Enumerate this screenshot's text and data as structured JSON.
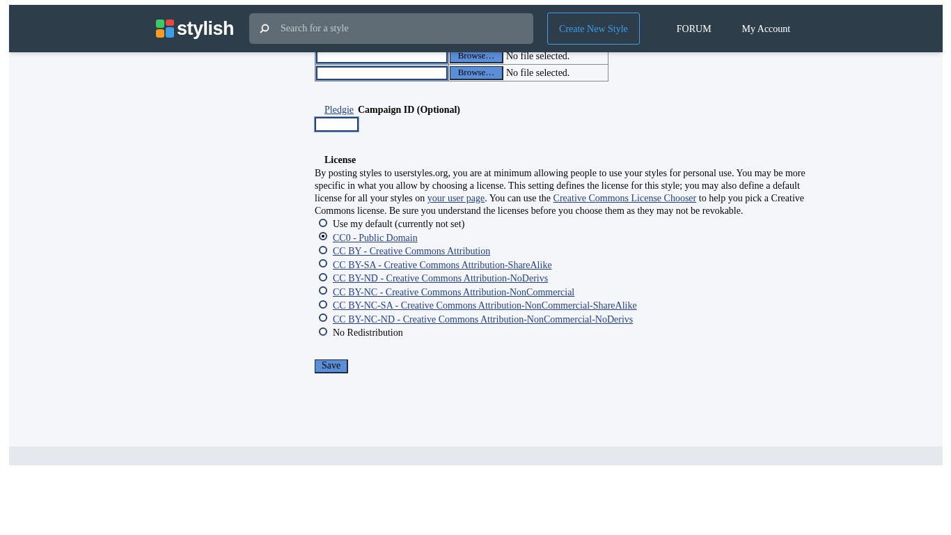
{
  "header": {
    "logo_text": "stylish",
    "search": {
      "placeholder": "Search for a style"
    },
    "create_button": "Create New Style",
    "nav": [
      "FORUM",
      "My Account"
    ]
  },
  "upload_rows": [
    {
      "button": "Browse…",
      "status": "No file selected."
    },
    {
      "button": "Browse…",
      "status": "No file selected."
    }
  ],
  "pledgie": {
    "link": "Pledgie",
    "label": "Campaign ID (Optional)"
  },
  "license": {
    "heading": "License",
    "description": [
      {
        "kind": "text",
        "text": "By posting styles to userstyles.org, you are at minimum allowing people to use your styles for personal use. You may be more specific in what you allow by choosing a license. This setting defines the license for this style; you may also define a default license for all your styles on "
      },
      {
        "kind": "link",
        "text": "your user page"
      },
      {
        "kind": "text",
        "text": ". You can use the "
      },
      {
        "kind": "link",
        "text": "Creative Commons License Chooser"
      },
      {
        "kind": "text",
        "text": " to help you pick a Creative Commons license. Be sure you understand the licenses before you choose them as they may not be revokable."
      }
    ],
    "options": [
      {
        "label": "Use my default (currently not set)",
        "link": false,
        "selected": false
      },
      {
        "label": "CC0 - Public Domain",
        "link": true,
        "selected": true
      },
      {
        "label": "CC BY - Creative Commons Attribution",
        "link": true,
        "selected": false
      },
      {
        "label": "CC BY-SA - Creative Commons Attribution-ShareAlike",
        "link": true,
        "selected": false
      },
      {
        "label": "CC BY-ND - Creative Commons Attribution-NoDerivs",
        "link": true,
        "selected": false
      },
      {
        "label": "CC BY-NC - Creative Commons Attribution-NonCommercial",
        "link": true,
        "selected": false
      },
      {
        "label": "CC BY-NC-SA - Creative Commons Attribution-NonCommercial-ShareAlike",
        "link": true,
        "selected": false
      },
      {
        "label": "CC BY-NC-ND - Creative Commons Attribution-NonCommercial-NoDerivs",
        "link": true,
        "selected": false
      },
      {
        "label": "No Redistribution",
        "link": false,
        "selected": false
      }
    ]
  },
  "save_button": "Save"
}
